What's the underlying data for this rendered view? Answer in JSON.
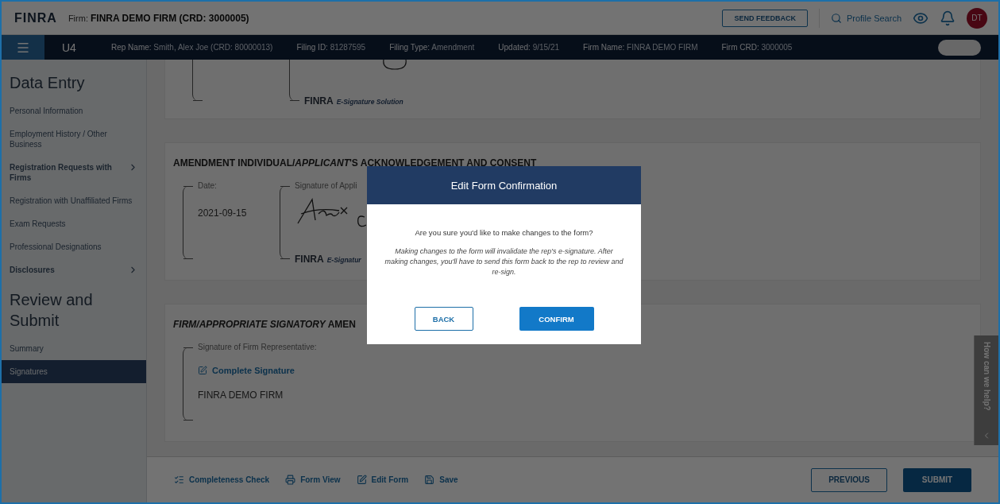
{
  "header": {
    "logo": "FINRA",
    "firm_label": "Firm:",
    "firm_name": "FINRA DEMO FIRM (CRD: 3000005)",
    "feedback_button": "SEND FEEDBACK",
    "search_link": "Profile Search",
    "avatar": "DT"
  },
  "filing_bar": {
    "form": "U4",
    "fields": [
      {
        "label": "Rep Name:",
        "value": "Smith, Alex Joe (CRD: 80000013)"
      },
      {
        "label": "Filing ID:",
        "value": "81287595"
      },
      {
        "label": "Filing Type:",
        "value": "Amendment"
      },
      {
        "label": "Updated:",
        "value": "9/15/21"
      },
      {
        "label": "Firm Name:",
        "value": "FINRA DEMO FIRM"
      },
      {
        "label": "Firm CRD:",
        "value": "3000005"
      }
    ]
  },
  "sidebar": {
    "entries": [
      {
        "kind": "heading",
        "label": "Data Entry"
      },
      {
        "kind": "item",
        "label": "Personal Information",
        "expandable": false,
        "selected": false
      },
      {
        "kind": "item",
        "label": "Employment History / Other Business",
        "expandable": false,
        "selected": false
      },
      {
        "kind": "item",
        "label": "Registration Requests with Firms",
        "expandable": true,
        "selected": false
      },
      {
        "kind": "item",
        "label": "Registration with Unaffiliated Firms",
        "expandable": false,
        "selected": false
      },
      {
        "kind": "item",
        "label": "Exam Requests",
        "expandable": false,
        "selected": false
      },
      {
        "kind": "item",
        "label": "Professional Designations",
        "expandable": false,
        "selected": false
      },
      {
        "kind": "item",
        "label": "Disclosures",
        "expandable": true,
        "selected": false
      },
      {
        "kind": "heading",
        "label": "Review and Submit"
      },
      {
        "kind": "item",
        "label": "Summary",
        "expandable": false,
        "selected": false
      },
      {
        "kind": "item",
        "label": "Signatures",
        "expandable": false,
        "selected": true
      }
    ]
  },
  "sections": [
    {
      "kind": "tail",
      "brand": "FINRA",
      "caption": "E-Signature Solution"
    },
    {
      "kind": "acknowledgement",
      "title": "AMENDMENT INDIVIDUAL/*APPLICANT*'S ACKNOWLEDGEMENT AND CONSENT",
      "fields": [
        {
          "kind": "date",
          "label": "Date:",
          "value": "2021-09-15"
        },
        {
          "kind": "signature",
          "label": "Signature of Appli",
          "brand": "FINRA",
          "caption": "E-Signatur"
        }
      ]
    },
    {
      "kind": "firm",
      "title": "*FIRM/APPROPRIATE SIGNATORY* AMEN",
      "fields": [
        {
          "kind": "pending",
          "label": "Signature of Firm Representative:",
          "link": "Complete Signature",
          "value": "FINRA DEMO FIRM"
        }
      ]
    }
  ],
  "footer": {
    "actions": [
      {
        "label": "Completeness Check"
      },
      {
        "label": "Form View"
      },
      {
        "label": "Edit Form"
      },
      {
        "label": "Save"
      }
    ],
    "previous": "PREVIOUS",
    "submit": "SUBMIT"
  },
  "help_tab": {
    "label": "How can we help?"
  },
  "modal": {
    "title": "Edit Form Confirmation",
    "question": "Are you sure you'd like to make changes to the form?",
    "warning": "Making changes to the form will invalidate the rep's e-signature. After making changes, you'll have to send this form back to the rep to review and re-sign.",
    "back": "BACK",
    "confirm": "CONFIRM"
  }
}
